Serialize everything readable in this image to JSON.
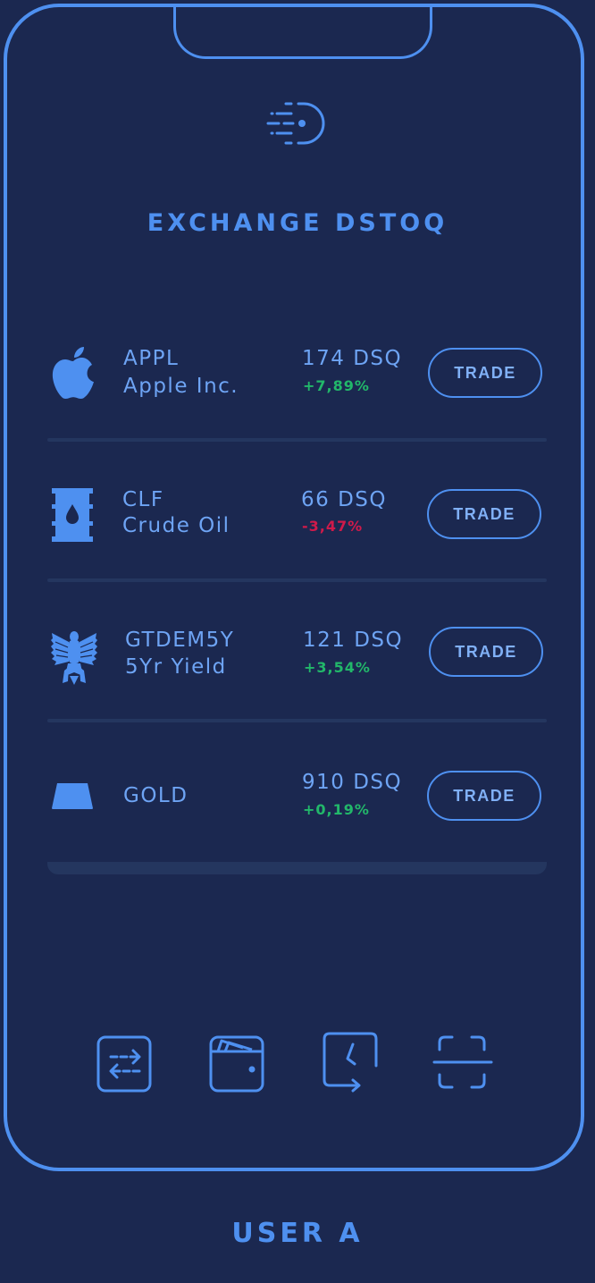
{
  "app": {
    "title": "EXCHANGE DSTOQ",
    "user_label": "USER A"
  },
  "assets": [
    {
      "icon": "apple-icon",
      "ticker": "APPL",
      "name": "Apple Inc.",
      "price": "174 DSQ",
      "change": "+7,89%",
      "trend": "up",
      "trade_label": "TRADE"
    },
    {
      "icon": "oil-barrel-icon",
      "ticker": "CLF",
      "name": "Crude Oil",
      "price": "66 DSQ",
      "change": "-3,47%",
      "trend": "down",
      "trade_label": "TRADE"
    },
    {
      "icon": "german-eagle-icon",
      "ticker": "GTDEM5Y",
      "name": "5Yr Yield",
      "price": "121 DSQ",
      "change": "+3,54%",
      "trend": "up",
      "trade_label": "TRADE"
    },
    {
      "icon": "gold-bar-icon",
      "ticker": "GOLD",
      "name": "",
      "price": "910 DSQ",
      "change": "+0,19%",
      "trend": "up",
      "trade_label": "TRADE"
    }
  ],
  "nav": [
    {
      "icon": "transfer-icon"
    },
    {
      "icon": "wallet-icon"
    },
    {
      "icon": "history-icon"
    },
    {
      "icon": "scan-icon"
    }
  ],
  "colors": {
    "background": "#1b2850",
    "accent": "#4e90f0",
    "positive": "#22b86a",
    "negative": "#d01a4a"
  }
}
